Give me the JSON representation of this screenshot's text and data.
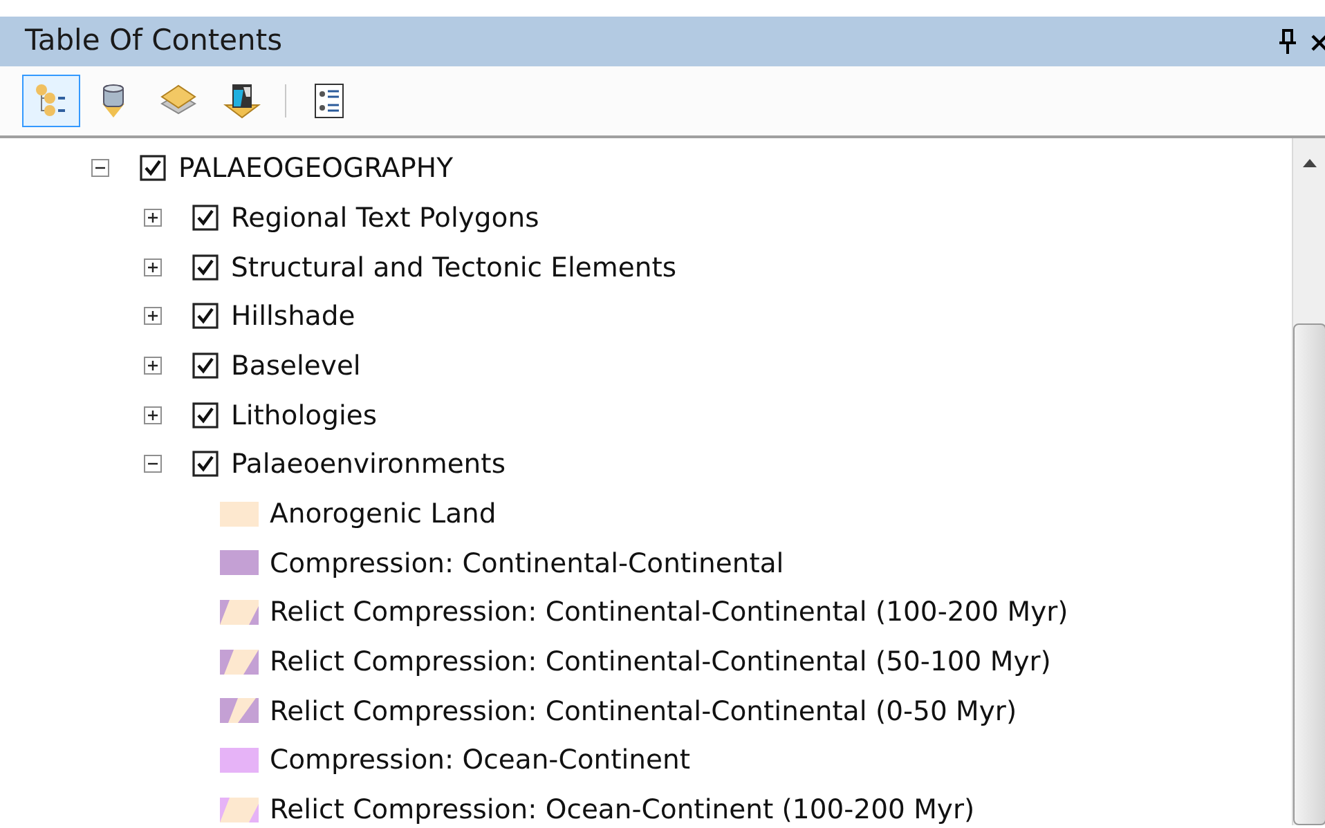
{
  "window": {
    "title": "Table Of Contents"
  },
  "toolbar": [
    {
      "kind": "drawing-order",
      "selected": true
    },
    {
      "kind": "source",
      "selected": false
    },
    {
      "kind": "visibility",
      "selected": false
    },
    {
      "kind": "selection",
      "selected": false
    },
    {
      "kind": "options",
      "selected": false
    }
  ],
  "tree": [
    {
      "label": "PALAEOGEOGRAPHY",
      "checked": true,
      "expanded": true,
      "children": [
        {
          "label": "Regional Text Polygons",
          "checked": true,
          "expanded": false
        },
        {
          "label": "Structural and Tectonic Elements",
          "checked": true,
          "expanded": false
        },
        {
          "label": "Hillshade",
          "checked": true,
          "expanded": false
        },
        {
          "label": "Baselevel",
          "checked": true,
          "expanded": false
        },
        {
          "label": "Lithologies",
          "checked": true,
          "expanded": false
        },
        {
          "label": "Palaeoenvironments",
          "checked": true,
          "expanded": true,
          "legend": [
            {
              "label": "Anorogenic Land",
              "kind": "solid",
              "color": "#fde8cf"
            },
            {
              "label": "Compression: Continental-Continental",
              "kind": "solid",
              "color": "#c4a0d4"
            },
            {
              "label": "Relict Compression: Continental-Continental (100-200 Myr)",
              "kind": "hatch-thin",
              "color": "#c4a0d4"
            },
            {
              "label": "Relict Compression: Continental-Continental (50-100 Myr)",
              "kind": "hatch-medium",
              "color": "#c4a0d4"
            },
            {
              "label": "Relict Compression: Continental-Continental (0-50 Myr)",
              "kind": "hatch-thick",
              "color": "#c4a0d4"
            },
            {
              "label": "Compression: Ocean-Continent",
              "kind": "solid",
              "color": "#e6b3f7"
            },
            {
              "label": "Relict Compression: Ocean-Continent (100-200 Myr)",
              "kind": "hatch-thin",
              "color": "#e6b3f7"
            }
          ]
        }
      ]
    }
  ]
}
